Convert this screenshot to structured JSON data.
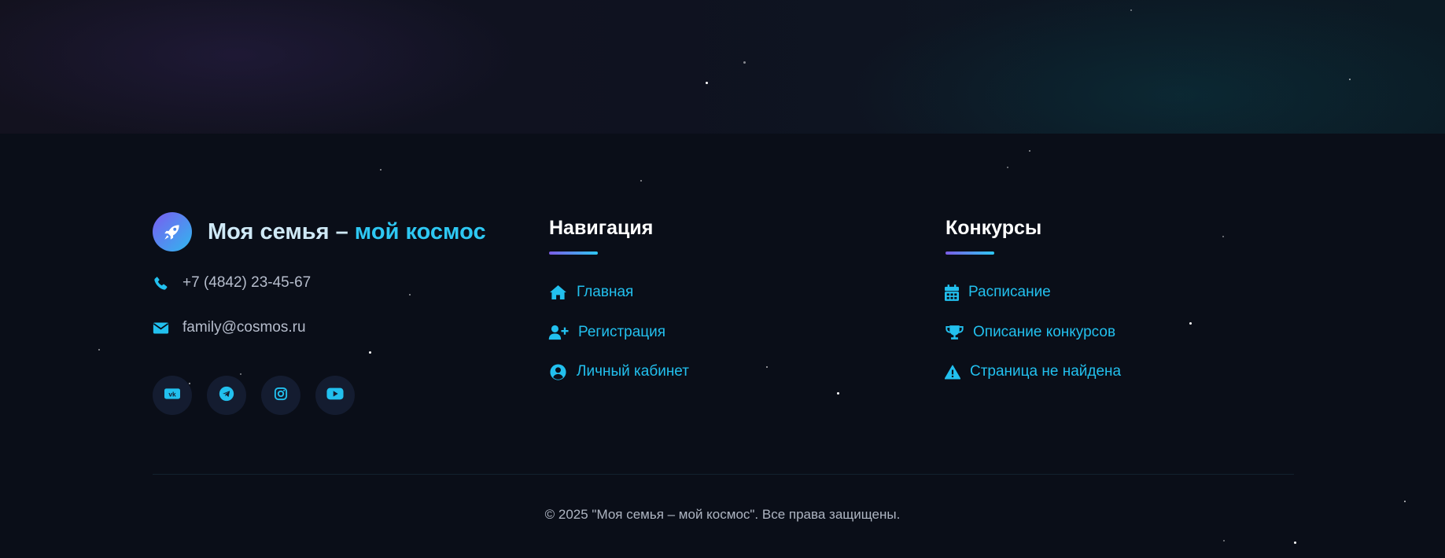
{
  "brand": {
    "title_white": "Моя семья –",
    "title_cyan": "мой космос",
    "logo_icon": "rocket-icon"
  },
  "contacts": {
    "phone": "+7 (4842) 23-45-67",
    "email": "family@cosmos.ru"
  },
  "socials": [
    {
      "name": "vk",
      "icon": "vk-icon"
    },
    {
      "name": "telegram",
      "icon": "telegram-icon"
    },
    {
      "name": "instagram",
      "icon": "instagram-icon"
    },
    {
      "name": "youtube",
      "icon": "youtube-icon"
    }
  ],
  "navigation": {
    "heading": "Навигация",
    "items": [
      {
        "label": "Главная",
        "icon": "home-icon"
      },
      {
        "label": "Регистрация",
        "icon": "user-plus-icon"
      },
      {
        "label": "Личный кабинет",
        "icon": "user-circle-icon"
      }
    ]
  },
  "contests": {
    "heading": "Конкурсы",
    "items": [
      {
        "label": "Расписание",
        "icon": "calendar-icon"
      },
      {
        "label": "Описание конкурсов",
        "icon": "trophy-icon"
      },
      {
        "label": "Страница не найдена",
        "icon": "warning-icon"
      }
    ]
  },
  "copyright": "© 2025 \"Моя семья – мой космос\". Все права защищены.",
  "colors": {
    "accent": "#22c0ee",
    "background": "#0a0e18",
    "gradient_start": "#7b5ce6",
    "gradient_end": "#2ec8f3"
  }
}
